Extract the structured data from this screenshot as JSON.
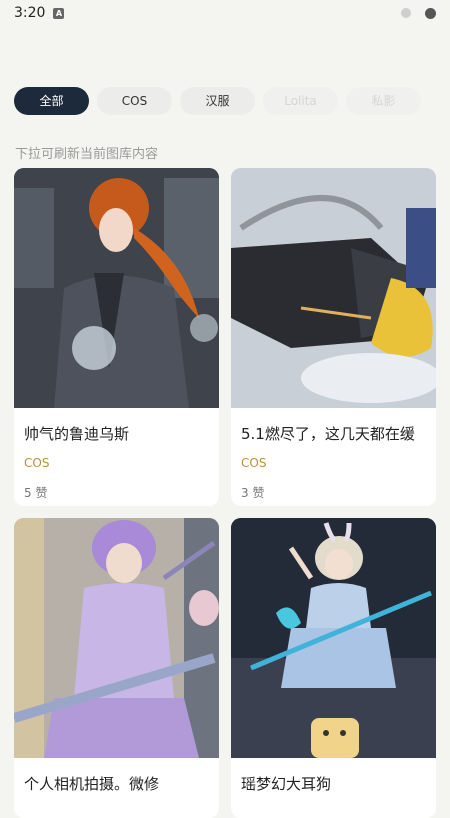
{
  "status": {
    "time": "3:20",
    "notif_badge": "A"
  },
  "tabs": [
    {
      "label": "全部",
      "active": true
    },
    {
      "label": "COS",
      "active": false
    },
    {
      "label": "汉服",
      "active": false
    },
    {
      "label": "Lolita",
      "active": false
    },
    {
      "label": "私影",
      "active": false
    }
  ],
  "hint": "下拉可刷新当前图库内容",
  "cards": [
    {
      "title": "帅气的鲁迪乌斯",
      "tag": "COS",
      "likes": "5 赞"
    },
    {
      "title": "5.1燃尽了，这几天都在缓",
      "tag": "COS",
      "likes": "3 赞"
    },
    {
      "title": "个人相机拍摄。微修",
      "tag": "",
      "likes": ""
    },
    {
      "title": "瑶梦幻大耳狗",
      "tag": "",
      "likes": ""
    }
  ],
  "colors": {
    "active_tab": "#1d2a3c",
    "tag": "#b8913b"
  }
}
